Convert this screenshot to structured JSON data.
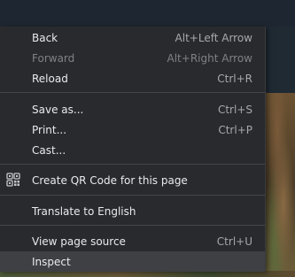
{
  "menu": {
    "items": [
      {
        "label": "Back",
        "shortcut": "Alt+Left Arrow"
      },
      {
        "label": "Forward",
        "shortcut": "Alt+Right Arrow"
      },
      {
        "label": "Reload",
        "shortcut": "Ctrl+R"
      },
      {
        "label": "Save as...",
        "shortcut": "Ctrl+S"
      },
      {
        "label": "Print...",
        "shortcut": "Ctrl+P"
      },
      {
        "label": "Cast...",
        "shortcut": ""
      },
      {
        "label": "Create QR Code for this page",
        "shortcut": "",
        "icon": "qr-code-icon"
      },
      {
        "label": "Translate to English",
        "shortcut": ""
      },
      {
        "label": "View page source",
        "shortcut": "Ctrl+U"
      },
      {
        "label": "Inspect",
        "shortcut": ""
      }
    ]
  },
  "colors": {
    "menu_background": "#292a2d",
    "text": "#e8eaed",
    "disabled_text": "#7f8185",
    "hover_background": "#3f4044"
  }
}
